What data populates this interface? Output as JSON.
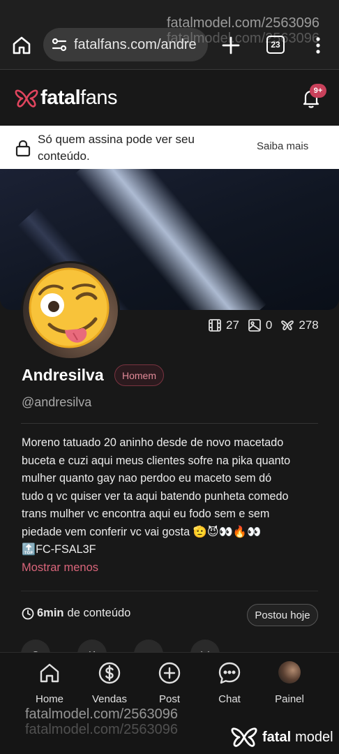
{
  "browser": {
    "url": "fatalfans.com/andre",
    "tab_count": "23",
    "watermark": "fatalmodel.com/2563096"
  },
  "header": {
    "logo_bold": "fatal",
    "logo_light": "fans",
    "notification_badge": "9+"
  },
  "notice": {
    "text": "Só quem assina pode ver seu conteúdo.",
    "link": "Saiba mais"
  },
  "profile": {
    "name": "Andresilva",
    "tag": "Homem",
    "handle": "@andresilva",
    "stats": {
      "videos": "27",
      "photos": "0",
      "likes": "278"
    },
    "bio_lines": [
      "Moreno tatuado 20 aninho desde de novo macetado",
      "buceta e cuzi aqui meus clientes sofre na pika quanto",
      "mulher quanto gay nao perdoo eu maceto sem dó",
      "tudo q vc quiser ver ta aqui batendo punheta comedo",
      "trans mulher vc encontra aqui eu fodo sem e sem",
      "piedade vem conferir vc vai gosta 🫡😈👀🔥👀",
      "🔝FC-FSAL3F"
    ],
    "show_less": "Mostrar menos",
    "content_duration": "6min",
    "content_suffix": "de conteúdo",
    "posted": "Postou hoje"
  },
  "nav": {
    "items": [
      {
        "label": "Home",
        "icon": "home-icon"
      },
      {
        "label": "Vendas",
        "icon": "dollar-icon"
      },
      {
        "label": "Post",
        "icon": "plus-circle-icon"
      },
      {
        "label": "Chat",
        "icon": "chat-icon"
      },
      {
        "label": "Painel",
        "icon": "avatar"
      }
    ]
  },
  "footer_watermark": {
    "text": "fatalmodel.com/2563096",
    "logo_bold": "fatal",
    "logo_light": "model"
  },
  "colors": {
    "accent": "#d9657a",
    "badge": "#c9415b",
    "background": "#181818"
  }
}
